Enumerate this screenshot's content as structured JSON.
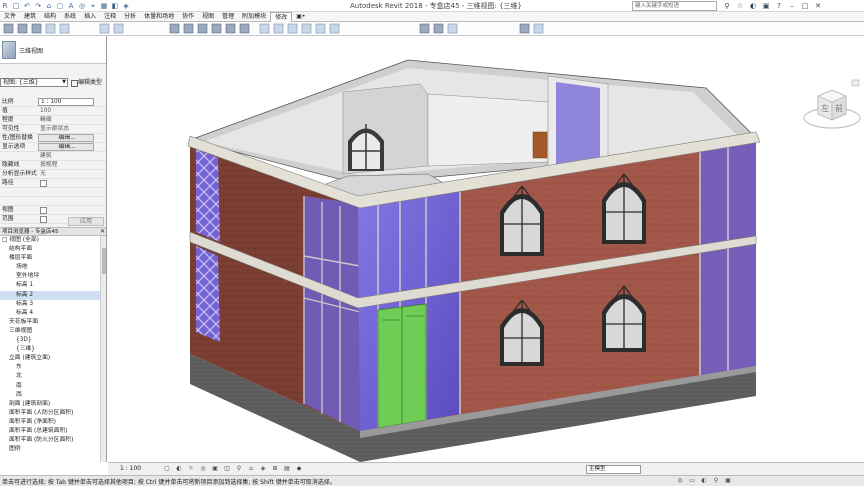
{
  "app": {
    "title": "Autodesk Revit 2018 -    专盒店45 - 三维视图: {三维}",
    "search_placeholder": "键入关键字或短语"
  },
  "quick_access": [
    "R",
    "□",
    "↶",
    "↷",
    "⌂",
    "▢",
    "A",
    "◎",
    "⌖",
    "▦",
    "◧",
    "◈"
  ],
  "ribbon_tabs": [
    {
      "label": "文件"
    },
    {
      "label": "建筑"
    },
    {
      "label": "结构"
    },
    {
      "label": "系统"
    },
    {
      "label": "插入"
    },
    {
      "label": "注释"
    },
    {
      "label": "分析"
    },
    {
      "label": "体量和场地"
    },
    {
      "label": "协作"
    },
    {
      "label": "视图"
    },
    {
      "label": "管理"
    },
    {
      "label": "附加模块"
    },
    {
      "label": "修改"
    },
    {
      "label": "▣•"
    }
  ],
  "properties": {
    "type_name": "三维视图",
    "view_select": "视图: {三维}",
    "edit_type": "编辑类型",
    "rows": [
      {
        "label": "比例",
        "value": "1 : 100",
        "kind": "box"
      },
      {
        "label": "值",
        "value": "100",
        "kind": "text"
      },
      {
        "label": "程度",
        "value": "精细",
        "kind": "text"
      },
      {
        "label": "可见性",
        "value": "显示原状态",
        "kind": "text"
      },
      {
        "label": "性/图形替换",
        "value": "编辑...",
        "kind": "btn"
      },
      {
        "label": "显示选项",
        "value": "编辑...",
        "kind": "btn"
      },
      {
        "label": "",
        "value": "建筑",
        "kind": "text"
      },
      {
        "label": "隐藏线",
        "value": "按规程",
        "kind": "text"
      },
      {
        "label": "分析显示样式",
        "value": "无",
        "kind": "text"
      },
      {
        "label": "路径",
        "value": "",
        "kind": "chk"
      },
      {
        "label": "",
        "value": "",
        "kind": "text"
      },
      {
        "label": "",
        "value": "",
        "kind": "text"
      },
      {
        "label": "视图",
        "value": "",
        "kind": "chk"
      },
      {
        "label": "范围",
        "value": "",
        "kind": "chk"
      }
    ],
    "apply": "应用"
  },
  "browser": {
    "title": "项目浏览器 - 专盒店45",
    "tree": [
      {
        "label": "□ 视图 (全部)",
        "indent": 0
      },
      {
        "label": "结构平面",
        "indent": 1
      },
      {
        "label": "楼层平面",
        "indent": 1
      },
      {
        "label": "场地",
        "indent": 2
      },
      {
        "label": "室外地坪",
        "indent": 2
      },
      {
        "label": "标高 1",
        "indent": 2
      },
      {
        "label": "标高 2",
        "indent": 2,
        "selected": true
      },
      {
        "label": "标高 3",
        "indent": 2
      },
      {
        "label": "标高 4",
        "indent": 2
      },
      {
        "label": "天花板平面",
        "indent": 1
      },
      {
        "label": "三维视图",
        "indent": 1
      },
      {
        "label": "{3D}",
        "indent": 2
      },
      {
        "label": "{三维}",
        "indent": 2
      },
      {
        "label": "立面 (建筑立面)",
        "indent": 1
      },
      {
        "label": "东",
        "indent": 2
      },
      {
        "label": "北",
        "indent": 2
      },
      {
        "label": "南",
        "indent": 2
      },
      {
        "label": "西",
        "indent": 2
      },
      {
        "label": "剖面 (建筑剖面)",
        "indent": 1
      },
      {
        "label": "面积平面 (人防分区面积)",
        "indent": 1
      },
      {
        "label": "面积平面 (净面积)",
        "indent": 1
      },
      {
        "label": "面积平面 (总建筑面积)",
        "indent": 1
      },
      {
        "label": "面积平面 (防火分区面积)",
        "indent": 1
      },
      {
        "label": "图例",
        "indent": 1
      }
    ]
  },
  "viewcube": {
    "face": "前",
    "side": "左"
  },
  "viewbar": {
    "scale": "1 : 100",
    "icons": [
      "▢",
      "◐",
      "☼",
      "◎",
      "▣",
      "◫",
      "⚲",
      "⌂",
      "◈",
      "⊞",
      "▤",
      "◆"
    ],
    "model": "主模型"
  },
  "status": {
    "text": "单击可进行选择; 按 Tab 键并单击可选择其他项目; 按 Ctrl 键并单击可将新项目添加到选择集; 按 Shift 键并单击可取消选择。",
    "right_icons": [
      "◎",
      "▭",
      "◐",
      "⚲",
      "▣"
    ]
  },
  "colors": {
    "brick": "#a4584a",
    "glass": "#6c5ccc",
    "door": "#6fcc55",
    "trim": "#d8d8cf",
    "base": "#5c5c5c",
    "ribbon_accent": "#2b5797"
  }
}
